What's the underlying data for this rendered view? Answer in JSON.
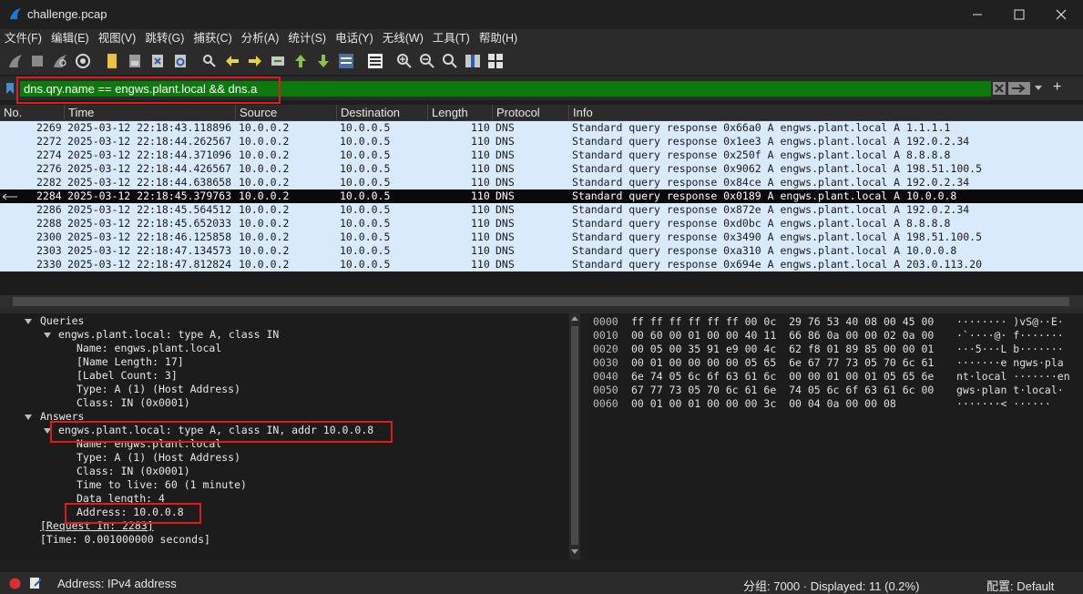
{
  "window": {
    "title": "challenge.pcap"
  },
  "menu": [
    "文件(F)",
    "编辑(E)",
    "视图(V)",
    "跳转(G)",
    "捕获(C)",
    "分析(A)",
    "统计(S)",
    "电话(Y)",
    "无线(W)",
    "工具(T)",
    "帮助(H)"
  ],
  "filter": {
    "value": "dns.qry.name == engws.plant.local && dns.a",
    "add_label": "+"
  },
  "columns": [
    "No.",
    "Time",
    "Source",
    "Destination",
    "Length",
    "Protocol",
    "Info"
  ],
  "packets": [
    {
      "no": "2269",
      "time": "2025-03-12 22:18:43.118896",
      "src": "10.0.0.2",
      "dst": "10.0.0.5",
      "len": "110",
      "proto": "DNS",
      "info": "Standard query response 0x66a0 A engws.plant.local A 1.1.1.1"
    },
    {
      "no": "2272",
      "time": "2025-03-12 22:18:44.262567",
      "src": "10.0.0.2",
      "dst": "10.0.0.5",
      "len": "110",
      "proto": "DNS",
      "info": "Standard query response 0x1ee3 A engws.plant.local A 192.0.2.34"
    },
    {
      "no": "2274",
      "time": "2025-03-12 22:18:44.371096",
      "src": "10.0.0.2",
      "dst": "10.0.0.5",
      "len": "110",
      "proto": "DNS",
      "info": "Standard query response 0x250f A engws.plant.local A 8.8.8.8"
    },
    {
      "no": "2276",
      "time": "2025-03-12 22:18:44.426567",
      "src": "10.0.0.2",
      "dst": "10.0.0.5",
      "len": "110",
      "proto": "DNS",
      "info": "Standard query response 0x9062 A engws.plant.local A 198.51.100.5"
    },
    {
      "no": "2282",
      "time": "2025-03-12 22:18:44.638658",
      "src": "10.0.0.2",
      "dst": "10.0.0.5",
      "len": "110",
      "proto": "DNS",
      "info": "Standard query response 0x84ce A engws.plant.local A 192.0.2.34"
    },
    {
      "no": "2284",
      "time": "2025-03-12 22:18:45.379763",
      "src": "10.0.0.2",
      "dst": "10.0.0.5",
      "len": "110",
      "proto": "DNS",
      "info": "Standard query response 0x0189 A engws.plant.local A 10.0.0.8"
    },
    {
      "no": "2286",
      "time": "2025-03-12 22:18:45.564512",
      "src": "10.0.0.2",
      "dst": "10.0.0.5",
      "len": "110",
      "proto": "DNS",
      "info": "Standard query response 0x872e A engws.plant.local A 192.0.2.34"
    },
    {
      "no": "2288",
      "time": "2025-03-12 22:18:45.652033",
      "src": "10.0.0.2",
      "dst": "10.0.0.5",
      "len": "110",
      "proto": "DNS",
      "info": "Standard query response 0xd0bc A engws.plant.local A 8.8.8.8"
    },
    {
      "no": "2300",
      "time": "2025-03-12 22:18:46.125858",
      "src": "10.0.0.2",
      "dst": "10.0.0.5",
      "len": "110",
      "proto": "DNS",
      "info": "Standard query response 0x3490 A engws.plant.local A 198.51.100.5"
    },
    {
      "no": "2303",
      "time": "2025-03-12 22:18:47.134573",
      "src": "10.0.0.2",
      "dst": "10.0.0.5",
      "len": "110",
      "proto": "DNS",
      "info": "Standard query response 0xa310 A engws.plant.local A 10.0.0.8"
    },
    {
      "no": "2330",
      "time": "2025-03-12 22:18:47.812824",
      "src": "10.0.0.2",
      "dst": "10.0.0.5",
      "len": "110",
      "proto": "DNS",
      "info": "Standard query response 0x694e A engws.plant.local A 203.0.113.20"
    }
  ],
  "detail": {
    "queries": "Queries",
    "query": "engws.plant.local: type A, class IN",
    "q_name": "Name: engws.plant.local",
    "q_len": "[Name Length: 17]",
    "q_label": "[Label Count: 3]",
    "q_type": "Type: A (1) (Host Address)",
    "q_class": "Class: IN (0x0001)",
    "answers": "Answers",
    "answer": "engws.plant.local: type A, class IN, addr 10.0.0.8",
    "a_name": "Name: engws.plant.local",
    "a_type": "Type: A (1) (Host Address)",
    "a_class": "Class: IN (0x0001)",
    "a_ttl": "Time to live: 60 (1 minute)",
    "a_len": "Data length: 4",
    "a_addr": "Address: 10.0.0.8",
    "request_in": "[Request In: 2283]",
    "time": "[Time: 0.001000000 seconds]"
  },
  "hex": {
    "offsets": [
      "0000",
      "0010",
      "0020",
      "0030",
      "0040",
      "0050",
      "0060"
    ],
    "bytes": [
      "ff ff ff ff ff ff 00 0c  29 76 53 40 08 00 45 00",
      "00 60 00 01 00 00 40 11  66 86 0a 00 00 02 0a 00",
      "00 05 00 35 91 e9 00 4c  62 f8 01 89 85 00 00 01",
      "00 01 00 00 00 00 05 65  6e 67 77 73 05 70 6c 61",
      "6e 74 05 6c 6f 63 61 6c  00 00 01 00 01 05 65 6e",
      "67 77 73 05 70 6c 61 6e  74 05 6c 6f 63 61 6c 00",
      "00 01 00 01 00 00 00 3c  00 04 0a 00 00 08"
    ],
    "ascii": [
      "········ )vS@··E·",
      "·`····@· f·······",
      "···5···L b·······",
      "·······e ngws·pla",
      "nt·local ·······en",
      "gws·plan t·local·",
      "·······< ······"
    ]
  },
  "status": {
    "left": "Address: IPv4 address",
    "packets": "分组: 7000 · Displayed: 11 (0.2%)",
    "profile": "配置: Default"
  },
  "colors": {
    "filter_ok": "#0c7a0c",
    "row_bg": "#d9eafd",
    "selected_bg": "#0a0a0a",
    "highlight_box": "#e01b1b"
  }
}
